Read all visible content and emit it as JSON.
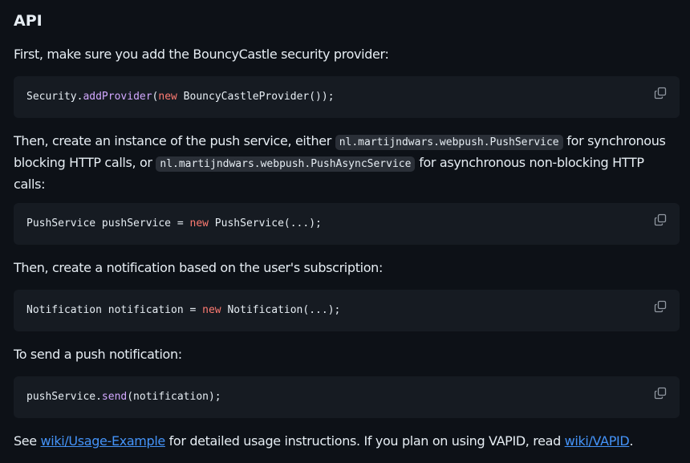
{
  "heading": "API",
  "para1": "First, make sure you add the BouncyCastle security provider:",
  "code1": {
    "p1": "Security.",
    "fn": "addProvider",
    "p2": "(",
    "kw": "new",
    "p3": " BouncyCastleProvider());"
  },
  "para2": {
    "t1": "Then, create an instance of the push service, either ",
    "c1": "nl.martijndwars.webpush.PushService",
    "t2": " for synchronous blocking HTTP calls, or ",
    "c2": "nl.martijndwars.webpush.PushAsyncService",
    "t3": " for asynchronous non-blocking HTTP calls:"
  },
  "code2": {
    "p1": "PushService pushService = ",
    "kw": "new",
    "p2": " PushService(...);"
  },
  "para3": "Then, create a notification based on the user's subscription:",
  "code3": {
    "p1": "Notification notification = ",
    "kw": "new",
    "p2": " Notification(...);"
  },
  "para4": "To send a push notification:",
  "code4": {
    "p1": "pushService.",
    "fn": "send",
    "p2": "(notification);"
  },
  "para5": {
    "t1": "See ",
    "link1": "wiki/Usage-Example",
    "t2": " for detailed usage instructions. If you plan on using VAPID, read ",
    "link2": "wiki/VAPID",
    "t3": "."
  },
  "icons": {
    "copy": "copy-icon"
  },
  "colors": {
    "background": "#0d1117",
    "code_background": "#161b22",
    "text": "#e6edf3",
    "keyword": "#ff7b72",
    "function": "#d2a8ff",
    "link": "#4493f8"
  }
}
